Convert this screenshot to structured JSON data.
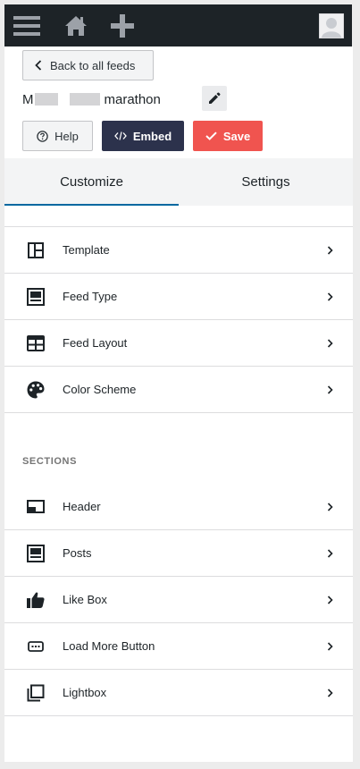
{
  "topbar": {
    "menu_icon": "hamburger-icon",
    "home_icon": "home-icon",
    "add_icon": "plus-icon",
    "user_icon": "avatar-icon"
  },
  "back_button": {
    "label": "Back to all feeds"
  },
  "feed": {
    "name_suffix": "marathon"
  },
  "actions": {
    "help_label": "Help",
    "embed_label": "Embed",
    "save_label": "Save"
  },
  "tabs": [
    {
      "label": "Customize",
      "active": true
    },
    {
      "label": "Settings",
      "active": false
    }
  ],
  "customize_items": [
    {
      "label": "Template",
      "icon": "template-icon"
    },
    {
      "label": "Feed Type",
      "icon": "feed-type-icon"
    },
    {
      "label": "Feed Layout",
      "icon": "feed-layout-icon"
    },
    {
      "label": "Color Scheme",
      "icon": "palette-icon"
    }
  ],
  "sections": {
    "title": "SECTIONS",
    "items": [
      {
        "label": "Header",
        "icon": "header-icon"
      },
      {
        "label": "Posts",
        "icon": "posts-icon"
      },
      {
        "label": "Like Box",
        "icon": "thumbs-up-icon"
      },
      {
        "label": "Load More Button",
        "icon": "load-more-icon"
      },
      {
        "label": "Lightbox",
        "icon": "lightbox-icon"
      }
    ]
  },
  "colors": {
    "topbar": "#1d2327",
    "embed": "#2c324c",
    "save": "#f0544f",
    "active_tab": "#0068a0"
  }
}
